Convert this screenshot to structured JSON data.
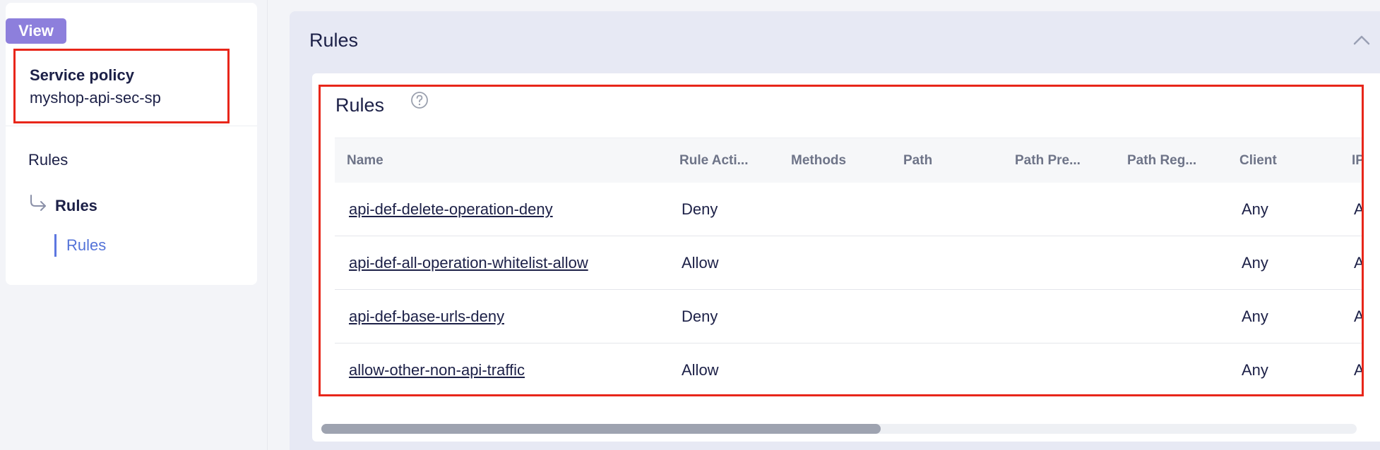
{
  "sidebar": {
    "view_badge": "View",
    "policy_label": "Service policy",
    "policy_name": "myshop-api-sec-sp",
    "nav_top": "Rules",
    "nav_section": "Rules",
    "nav_active": "Rules"
  },
  "section": {
    "title": "Rules",
    "inner_title": "Rules"
  },
  "table": {
    "headers": {
      "name": "Name",
      "rule_action": "Rule Acti...",
      "methods": "Methods",
      "path": "Path",
      "path_prefix": "Path Pre...",
      "path_regex": "Path Reg...",
      "client": "Client",
      "ip": "IP"
    },
    "rows": [
      {
        "name": "api-def-delete-operation-deny",
        "rule_action": "Deny",
        "client": "Any",
        "ip": "A"
      },
      {
        "name": "api-def-all-operation-whitelist-allow",
        "rule_action": "Allow",
        "client": "Any",
        "ip": "A"
      },
      {
        "name": "api-def-base-urls-deny",
        "rule_action": "Deny",
        "client": "Any",
        "ip": "A"
      },
      {
        "name": "allow-other-non-api-traffic",
        "rule_action": "Allow",
        "client": "Any",
        "ip": "A"
      }
    ]
  },
  "colors": {
    "accent_purple": "#8d7fdc",
    "highlight_red": "#e8261a",
    "active_blue": "#5473d8",
    "text_dark": "#1c2047"
  },
  "icons": {
    "nav_arrow": "corner-down-right-icon",
    "help": "help-circle-icon",
    "collapse": "chevron-up-icon"
  }
}
